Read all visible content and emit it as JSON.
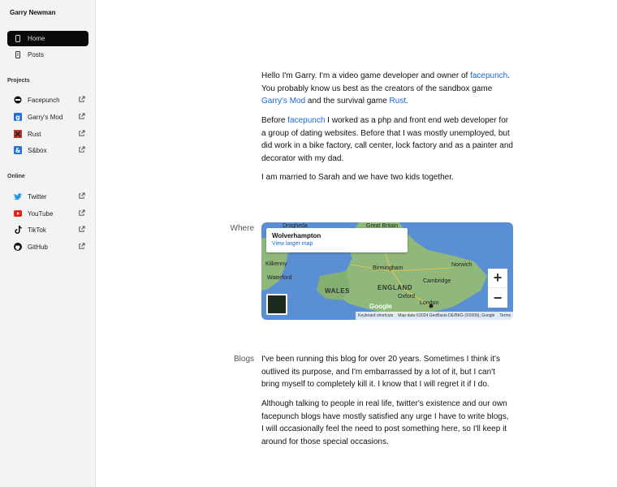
{
  "sidebar": {
    "site_title": "Garry Newman",
    "nav": [
      {
        "label": "Home",
        "icon": "home-icon",
        "active": true
      },
      {
        "label": "Posts",
        "icon": "posts-icon",
        "active": false
      }
    ],
    "projects_label": "Projects",
    "projects": [
      {
        "label": "Facepunch",
        "icon": "facepunch-icon"
      },
      {
        "label": "Garry's Mod",
        "icon": "garrys-mod-icon"
      },
      {
        "label": "Rust",
        "icon": "rust-icon"
      },
      {
        "label": "S&box",
        "icon": "sbox-icon"
      }
    ],
    "online_label": "Online",
    "online": [
      {
        "label": "Twitter",
        "icon": "twitter-icon"
      },
      {
        "label": "YouTube",
        "icon": "youtube-icon"
      },
      {
        "label": "TikTok",
        "icon": "tiktok-icon"
      },
      {
        "label": "GitHub",
        "icon": "github-icon"
      }
    ]
  },
  "intro": {
    "p1_a": "Hello I'm Garry. I'm a video game developer and owner of ",
    "p1_link1": "facepunch",
    "p1_b": ". You probably know us best as the creators of the sandbox game ",
    "p1_link2": "Garry's Mod",
    "p1_c": " and the survival game ",
    "p1_link3": "Rust",
    "p1_d": ".",
    "p2_a": "Before ",
    "p2_link": "facepunch",
    "p2_b": " I worked as a php and front end web developer for a group of dating websites. Before that I was mostly unemployed, but did work in a bike factory, call center, lock factory and as a painter and decorator with my dad.",
    "p3": "I am married to Sarah and we have two kids together."
  },
  "where": {
    "label": "Where",
    "map": {
      "place_name": "Wolverhampton",
      "view_larger": "View larger map",
      "zoom_in": "+",
      "zoom_out": "−",
      "labels": {
        "drogheda": "Drogheda",
        "great_britain": "Great Britain",
        "kilkenny": "Kilkenny",
        "waterford": "Waterford",
        "birmingham": "Birmingham",
        "norwich": "Norwich",
        "wales": "WALES",
        "england": "ENGLAND",
        "cambridge": "Cambridge",
        "oxford": "Oxford",
        "london": "London"
      },
      "google": "Google",
      "footer_shortcuts": "Keyboard shortcuts",
      "footer_data": "Map data ©2024 GeoBasis-DE/BKG (©2009), Google",
      "footer_terms": "Terms"
    }
  },
  "blogs": {
    "label": "Blogs",
    "p1": "I've been running this blog for over 20 years. Sometimes I think it's outlived its purpose, and I'm embarrassed by a lot of it, but I can't bring myself to completely kill it. I know that I will regret it if I do.",
    "p2": "Although talking to people in real life, twitter's existence and our own facepunch blogs have mostly satisfied any urge I have to write blogs, I will occasionally feel the need to post something here, so I'll keep it around for those special occasions."
  },
  "colors": {
    "link": "#1a66d9",
    "sidebar_bg": "#f3f3f3",
    "active_nav_bg": "#0a0a0a",
    "sea": "#5b8fd4",
    "land": "#8fb87a"
  }
}
